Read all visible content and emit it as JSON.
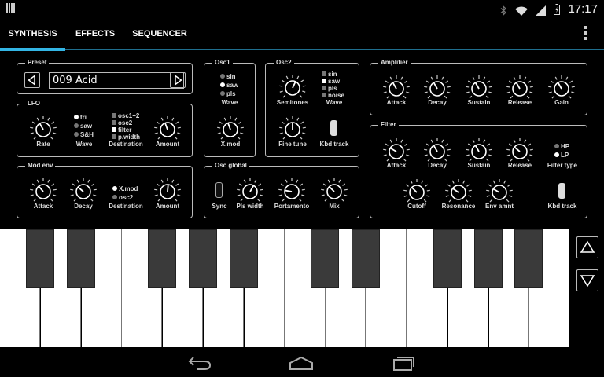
{
  "status": {
    "time": "17:17"
  },
  "tabs": [
    {
      "label": "SYNTHESIS",
      "active": true
    },
    {
      "label": "EFFECTS",
      "active": false
    },
    {
      "label": "SEQUENCER",
      "active": false
    }
  ],
  "preset": {
    "title": "Preset",
    "name": "009 Acid"
  },
  "lfo": {
    "title": "LFO",
    "knobs": {
      "rate": "Rate",
      "amount": "Amount"
    },
    "wave_label": "Wave",
    "wave_options": [
      {
        "label": "tri",
        "selected": true
      },
      {
        "label": "saw",
        "selected": false
      },
      {
        "label": "S&H",
        "selected": false
      }
    ],
    "destination_label": "Destination",
    "destination_options": [
      {
        "label": "osc1+2",
        "selected": false
      },
      {
        "label": "osc2",
        "selected": false
      },
      {
        "label": "filter",
        "selected": true
      },
      {
        "label": "p.width",
        "selected": false
      }
    ]
  },
  "mod_env": {
    "title": "Mod env",
    "knobs": {
      "attack": "Attack",
      "decay": "Decay",
      "amount": "Amount"
    },
    "destination_label": "Destination",
    "destination_options": [
      {
        "label": "X.mod",
        "selected": true
      },
      {
        "label": "osc2",
        "selected": false
      }
    ]
  },
  "osc1": {
    "title": "Osc1",
    "wave_label": "Wave",
    "wave_options": [
      {
        "label": "sin",
        "selected": false
      },
      {
        "label": "saw",
        "selected": true
      },
      {
        "label": "pls",
        "selected": false
      }
    ],
    "knobs": {
      "xmod": "X.mod"
    }
  },
  "osc2": {
    "title": "Osc2",
    "knobs": {
      "semitones": "Semitones",
      "fine_tune": "Fine tune"
    },
    "wave_label": "Wave",
    "wave_options": [
      {
        "label": "sin",
        "selected": false
      },
      {
        "label": "saw",
        "selected": true
      },
      {
        "label": "pls",
        "selected": false
      },
      {
        "label": "noise",
        "selected": false
      }
    ],
    "kbd_track_label": "Kbd track",
    "kbd_track_on": true
  },
  "osc_global": {
    "title": "Osc global",
    "sync_label": "Sync",
    "sync_on": false,
    "knobs": {
      "pls_width": "Pls width",
      "portamento": "Portamento",
      "mix": "Mix"
    }
  },
  "amplifier": {
    "title": "Amplifier",
    "knobs": {
      "attack": "Attack",
      "decay": "Decay",
      "sustain": "Sustain",
      "release": "Release",
      "gain": "Gain"
    }
  },
  "filter": {
    "title": "Filter",
    "knobs": {
      "attack": "Attack",
      "decay": "Decay",
      "sustain": "Sustain",
      "release": "Release",
      "cutoff": "Cutoff",
      "resonance": "Resonance",
      "env_amnt": "Env amnt"
    },
    "type_label": "Filter type",
    "type_options": [
      {
        "label": "HP",
        "selected": false
      },
      {
        "label": "LP",
        "selected": true
      }
    ],
    "kbd_track_label": "Kbd track",
    "kbd_track_on": true
  },
  "icons": {
    "status": [
      "bars-icon",
      "bluetooth-icon",
      "wifi-icon",
      "signal-icon",
      "battery-icon"
    ],
    "nav": [
      "back-icon",
      "home-icon",
      "recents-icon"
    ],
    "octave": [
      "octave-up-icon",
      "octave-down-icon"
    ]
  }
}
